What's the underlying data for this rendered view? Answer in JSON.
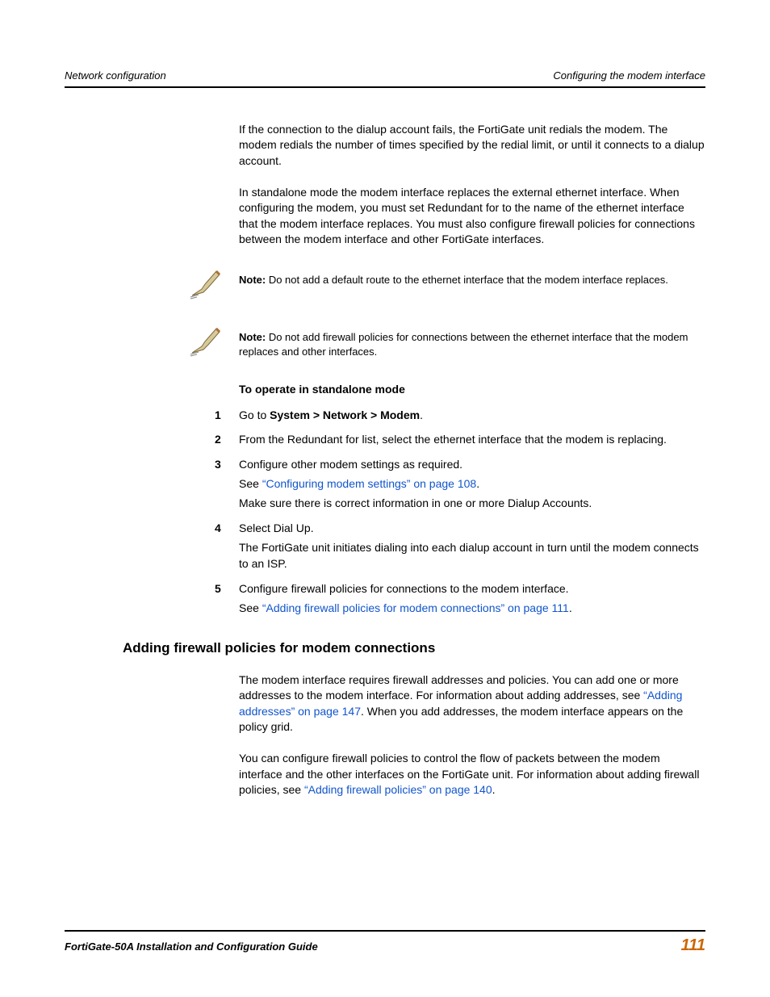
{
  "header": {
    "left": "Network configuration",
    "right": "Configuring the modem interface"
  },
  "p1": "If the connection to the dialup account fails, the FortiGate unit redials the modem. The modem redials the number of times specified by the redial limit, or until it connects to a dialup account.",
  "p2": "In standalone mode the modem interface replaces the external ethernet interface. When configuring the modem, you must set Redundant for to the name of the ethernet interface that the modem interface replaces. You must also configure firewall policies for connections between the modem interface and other FortiGate interfaces.",
  "note1_label": "Note:",
  "note1_text": " Do not add a default route to the ethernet interface that the modem interface replaces.",
  "note2_label": "Note:",
  "note2_text": " Do not add firewall policies for connections between the ethernet interface that the modem replaces and other interfaces.",
  "subheading": "To operate in standalone mode",
  "steps": [
    {
      "n": "1",
      "pre": "Go to ",
      "bold": "System > Network > Modem",
      "post": "."
    },
    {
      "n": "2",
      "text": "From the Redundant for list, select the ethernet interface that the modem is replacing."
    },
    {
      "n": "3",
      "text": "Configure other modem settings as required.",
      "line2_pre": "See ",
      "line2_link": "“Configuring modem settings” on page 108",
      "line2_post": ".",
      "line3": "Make sure there is correct information in one or more Dialup Accounts."
    },
    {
      "n": "4",
      "text": "Select Dial Up.",
      "line2": "The FortiGate unit initiates dialing into each dialup account in turn until the modem connects to an ISP."
    },
    {
      "n": "5",
      "text": "Configure firewall policies for connections to the modem interface.",
      "line2_pre": "See ",
      "line2_link": "“Adding firewall policies for modem connections” on page 111",
      "line2_post": "."
    }
  ],
  "h2": "Adding firewall policies for modem connections",
  "sec2_p1a": "The modem interface requires firewall addresses and policies. You can add one or more addresses to the modem interface. For information about adding addresses, see ",
  "sec2_p1_link": "“Adding addresses” on page 147",
  "sec2_p1b": ". When you add addresses, the modem interface appears on the policy grid.",
  "sec2_p2a": "You can configure firewall policies to control the flow of packets between the modem interface and the other interfaces on the FortiGate unit. For information about adding firewall policies, see ",
  "sec2_p2_link": "“Adding firewall policies” on page 140",
  "sec2_p2b": ".",
  "footer": {
    "title": "FortiGate-50A Installation and Configuration Guide",
    "page": "111"
  }
}
